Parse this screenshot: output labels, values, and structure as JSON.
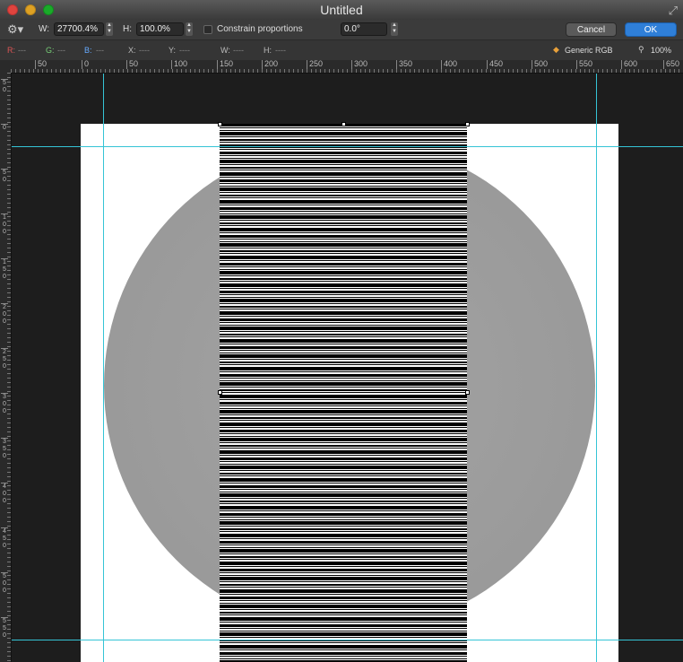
{
  "window": {
    "title": "Untitled"
  },
  "toolbar": {
    "width_label": "W:",
    "width_value": "27700.4%",
    "height_label": "H:",
    "height_value": "100.0%",
    "constrain_label": "Constrain proportions",
    "angle_value": "0.0°",
    "cancel_label": "Cancel",
    "ok_label": "OK",
    "accent": "#2f7fd8"
  },
  "info": {
    "r_label": "R:",
    "r_value": "---",
    "g_label": "G:",
    "g_value": "---",
    "b_label": "B:",
    "b_value": "---",
    "x_label": "X:",
    "x_value": "----",
    "y_label": "Y:",
    "y_value": "----",
    "w_label": "W:",
    "w_value": "----",
    "h_label": "H:",
    "h_value": "----",
    "color_profile": "Generic RGB",
    "zoom": "100%"
  },
  "ruler": {
    "h_ticks": [
      "50",
      "0",
      "50",
      "100",
      "150",
      "200",
      "250",
      "300",
      "350",
      "400",
      "450",
      "500",
      "550",
      "600",
      "650"
    ],
    "v_ticks": [
      "5 0",
      "0",
      "5 0",
      "1 0 0",
      "1 5 0",
      "2 0 0",
      "2 5 0",
      "3 0 0",
      "3 5 0",
      "4 0 0",
      "4 5 0",
      "5 0 0",
      "5 5 0"
    ]
  },
  "icons": {
    "gear": "gear-icon",
    "color": "color-profile-icon",
    "zoom": "zoom-icon",
    "fullscreen": "fullscreen-icon"
  }
}
